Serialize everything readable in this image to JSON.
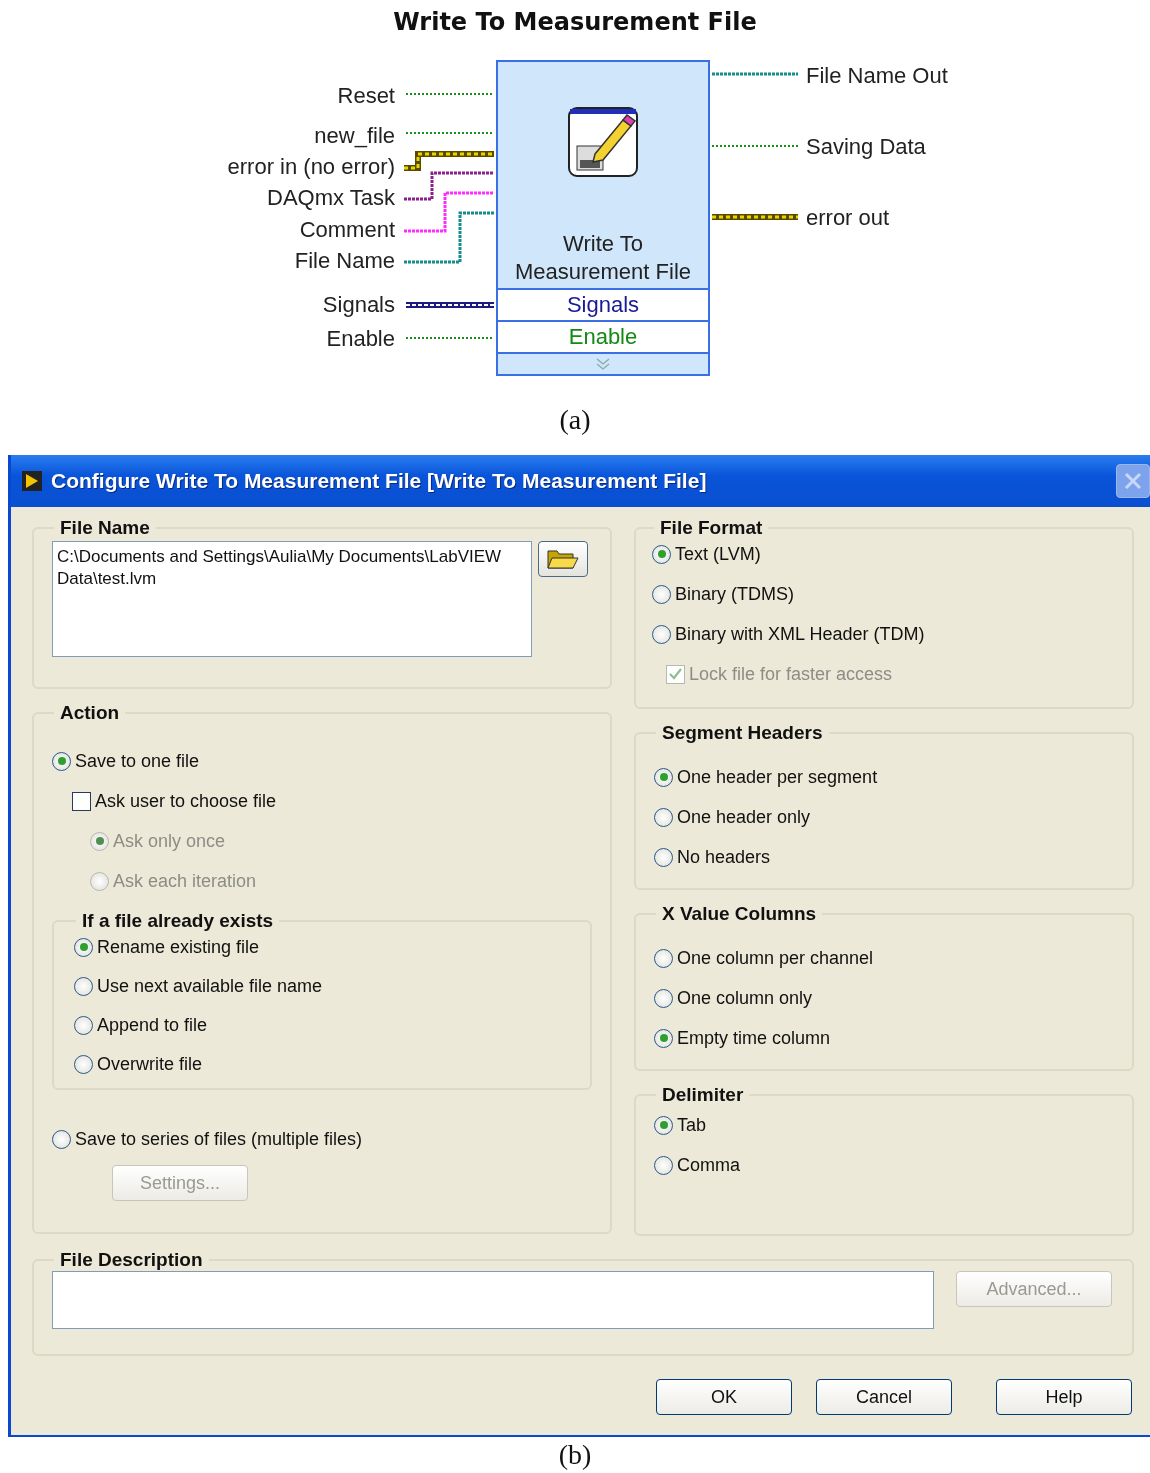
{
  "figure_a": {
    "title": "Write To Measurement File",
    "inputs": [
      {
        "label": "Reset",
        "kind": "boolean"
      },
      {
        "label": "new_file",
        "kind": "boolean"
      },
      {
        "label": "error in (no error)",
        "kind": "error"
      },
      {
        "label": "DAQmx Task",
        "kind": "task"
      },
      {
        "label": "Comment",
        "kind": "string"
      },
      {
        "label": "File Name",
        "kind": "path"
      },
      {
        "label": "Signals",
        "kind": "signal"
      },
      {
        "label": "Enable",
        "kind": "boolean"
      }
    ],
    "block": {
      "label": "Write To Measurement File",
      "terminals": [
        {
          "label": "Signals",
          "color": "#1a1a99"
        },
        {
          "label": "Enable",
          "color": "#138a13"
        }
      ]
    },
    "outputs": [
      {
        "label": "File Name Out",
        "kind": "path"
      },
      {
        "label": "Saving Data",
        "kind": "boolean"
      },
      {
        "label": "error out",
        "kind": "error"
      }
    ],
    "caption": "(a)"
  },
  "dialog": {
    "title": "Configure Write To Measurement File [Write To Measurement File]",
    "file_name": {
      "title": "File Name",
      "value": "C:\\Documents and Settings\\Aulia\\My Documents\\LabVIEW Data\\test.lvm"
    },
    "action": {
      "title": "Action",
      "save_one": {
        "label": "Save to one file",
        "selected": true
      },
      "ask_user": {
        "label": "Ask user to choose file",
        "checked": false
      },
      "ask_options": [
        {
          "label": "Ask only once",
          "selected": true,
          "disabled": true
        },
        {
          "label": "Ask each iteration",
          "selected": false,
          "disabled": true
        }
      ],
      "exists": {
        "title": "If a file already exists",
        "options": [
          {
            "label": "Rename existing file",
            "selected": true
          },
          {
            "label": "Use next available file name",
            "selected": false
          },
          {
            "label": "Append to file",
            "selected": false
          },
          {
            "label": "Overwrite file",
            "selected": false
          }
        ]
      },
      "save_series": {
        "label": "Save to series of files (multiple files)",
        "selected": false
      },
      "settings_button": {
        "label": "Settings...",
        "disabled": true
      }
    },
    "file_format": {
      "title": "File Format",
      "options": [
        {
          "label": "Text (LVM)",
          "selected": true
        },
        {
          "label": "Binary (TDMS)",
          "selected": false
        },
        {
          "label": "Binary with XML Header (TDM)",
          "selected": false
        }
      ],
      "lock": {
        "label": "Lock file for faster access",
        "checked": true,
        "disabled": true
      }
    },
    "segment_headers": {
      "title": "Segment Headers",
      "options": [
        {
          "label": "One header per segment",
          "selected": true
        },
        {
          "label": "One header only",
          "selected": false
        },
        {
          "label": "No headers",
          "selected": false
        }
      ]
    },
    "x_value_columns": {
      "title": "X Value Columns",
      "options": [
        {
          "label": "One column per channel",
          "selected": false
        },
        {
          "label": "One column only",
          "selected": false
        },
        {
          "label": "Empty time column",
          "selected": true
        }
      ]
    },
    "delimiter": {
      "title": "Delimiter",
      "options": [
        {
          "label": "Tab",
          "selected": true
        },
        {
          "label": "Comma",
          "selected": false
        }
      ]
    },
    "file_description": {
      "title": "File Description",
      "advanced_button": {
        "label": "Advanced...",
        "disabled": true
      }
    },
    "buttons": [
      "OK",
      "Cancel",
      "Help"
    ]
  },
  "caption_b": "(b)"
}
